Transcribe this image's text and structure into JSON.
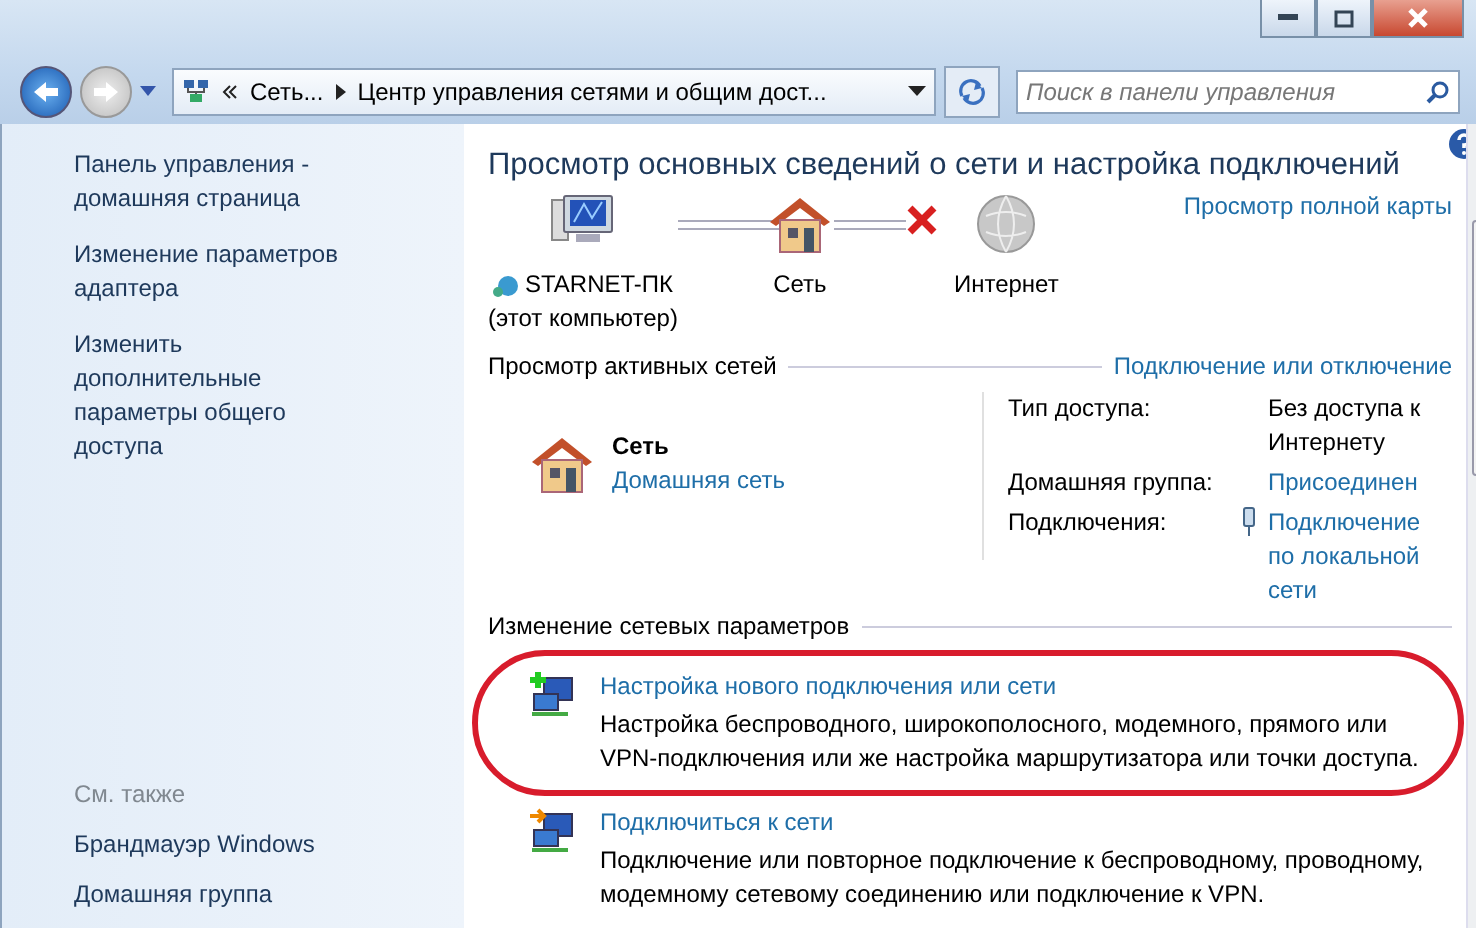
{
  "address_bar": {
    "crumbs": [
      "Сеть...",
      "Центр управления сетями и общим дост..."
    ]
  },
  "search": {
    "placeholder": "Поиск в панели управления"
  },
  "sidebar": {
    "links": [
      "Панель управления - домашняя страница",
      "Изменение параметров адаптера",
      "Изменить дополнительные параметры общего доступа"
    ],
    "see_also_title": "См. также",
    "see_also": [
      "Брандмауэр Windows",
      "Домашняя группа"
    ]
  },
  "main": {
    "title": "Просмотр основных сведений о сети и настройка подключений",
    "map_link": "Просмотр полной карты",
    "nodes": [
      {
        "kind": "computer",
        "label": "STARNET-ПК",
        "sublabel": "(этот компьютер)"
      },
      {
        "kind": "house",
        "label": "Сеть"
      },
      {
        "kind": "globe",
        "label": "Интернет"
      }
    ],
    "connections": [
      {
        "broken": false
      },
      {
        "broken": true
      }
    ],
    "active_networks": {
      "heading": "Просмотр активных сетей",
      "action": "Подключение или отключение",
      "network": {
        "name": "Сеть",
        "type": "Домашняя сеть"
      },
      "details": [
        {
          "label": "Тип доступа:",
          "value": "Без доступа к Интернету",
          "kind": "text"
        },
        {
          "label": "Домашняя группа:",
          "value": "Присоединен",
          "kind": "link"
        },
        {
          "label": "Подключения:",
          "value": "Подключение по локальной сети",
          "kind": "adapter-link"
        }
      ]
    },
    "change_settings": {
      "heading": "Изменение сетевых параметров",
      "tasks": [
        {
          "kind": "new",
          "title": "Настройка нового подключения или сети",
          "description": "Настройка беспроводного, широкополосного, модемного, прямого или VPN-подключения или же настройка маршрутизатора или точки доступа."
        },
        {
          "kind": "connect",
          "title": "Подключиться к сети",
          "description": "Подключение или повторное подключение к беспроводному, проводному, модемному сетевому соединению или подключение к VPN."
        }
      ]
    }
  }
}
